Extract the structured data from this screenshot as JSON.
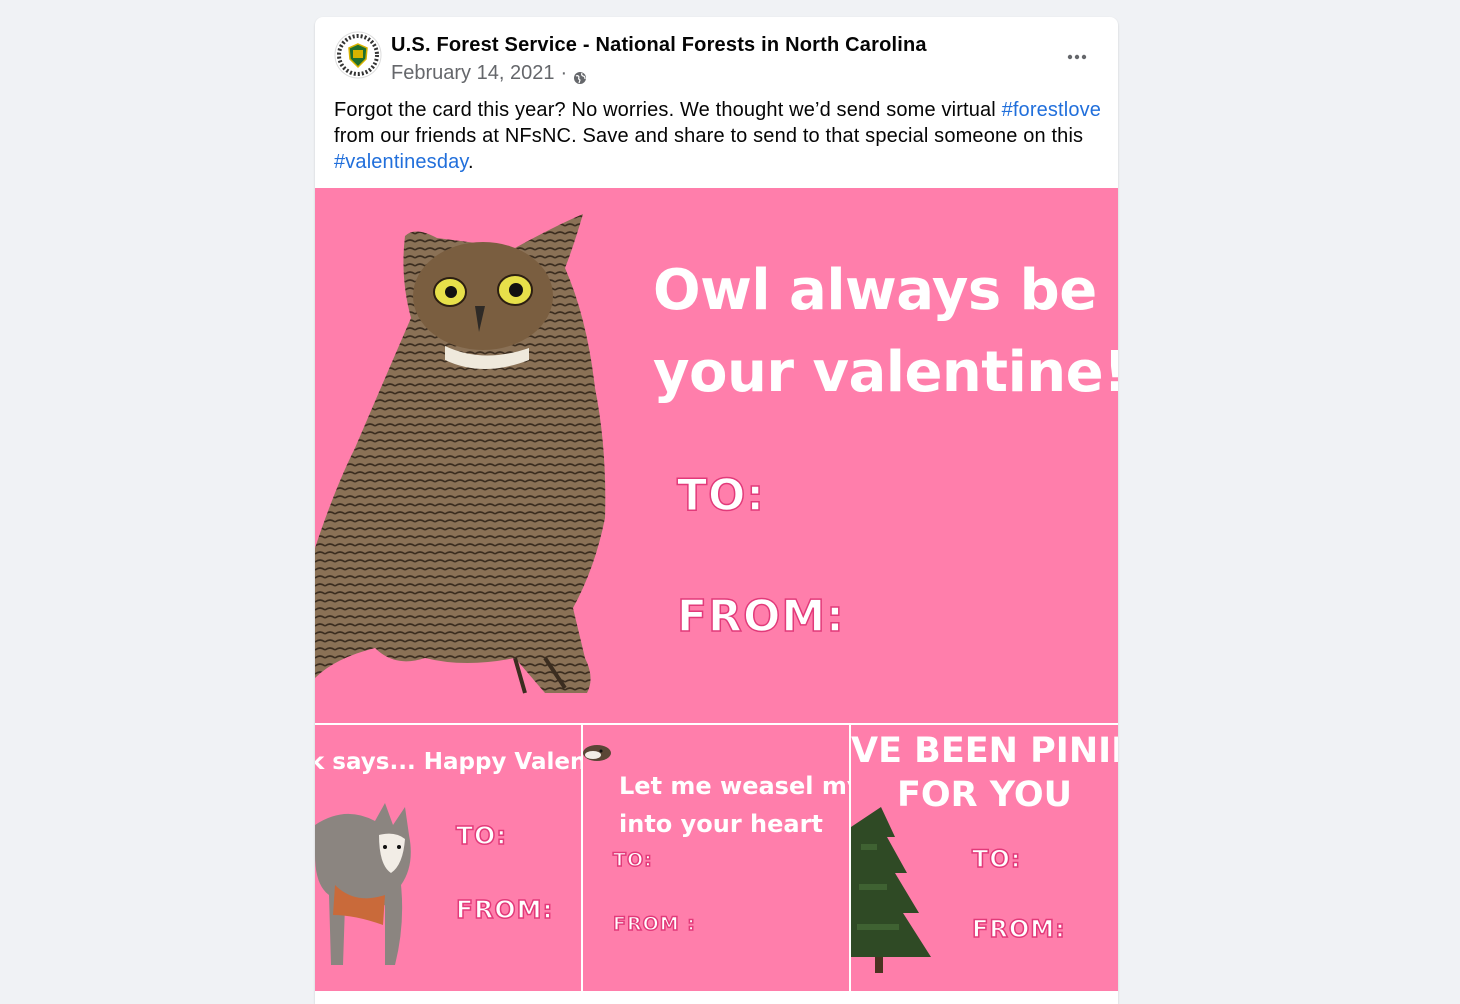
{
  "post": {
    "page_name": "U.S. Forest Service - National Forests in North Carolina",
    "date": "February 14, 2021",
    "separator": "·",
    "privacy_icon": "globe-icon",
    "more_icon": "more-options-icon",
    "caption": {
      "part1": "Forgot the card this year? No worries. We thought we’d send some virtual ",
      "hashtag1": "#forestlove",
      "part2": " from our friends at NFsNC. Save and share to send to that special someone on this ",
      "hashtag2": "#valentinesday",
      "part3": "."
    }
  },
  "cards": {
    "main": {
      "title_line1": "Owl always be",
      "title_line2": "your valentine!",
      "to": "TO:",
      "from": "FROM:"
    },
    "fox": {
      "headline": "k says... Happy Valentin",
      "to": "TO:",
      "from": "FROM:"
    },
    "weasel": {
      "line1": "Let me weasel my",
      "line2": "into your heart",
      "to": "TO:",
      "from": "FROM :"
    },
    "pine": {
      "line1": "VE BEEN PINII",
      "line2": "FOR YOU",
      "to": "TO:",
      "from": "FROM:"
    }
  },
  "colors": {
    "card_pink": "#ff7eab",
    "link_blue": "#216fdb",
    "page_bg": "#f0f2f5"
  }
}
